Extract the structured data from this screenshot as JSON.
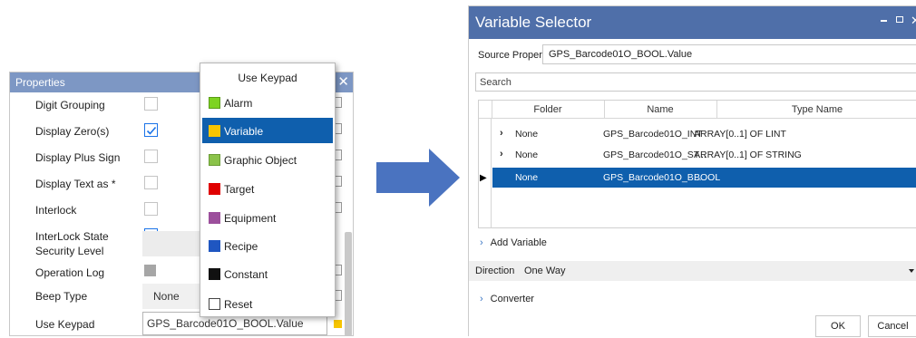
{
  "properties_panel": {
    "title": "Properties",
    "rows": [
      {
        "label": "Digit Grouping",
        "checked": false
      },
      {
        "label": "Display Zero(s)",
        "checked": true
      },
      {
        "label": "Display Plus Sign",
        "checked": false
      },
      {
        "label": "Display Text as *",
        "checked": false
      },
      {
        "label": "Interlock",
        "checked": false
      },
      {
        "label": "InterLock State",
        "checked": true
      },
      {
        "label": "Security Level"
      },
      {
        "label": "Operation Log"
      },
      {
        "label": "Beep Type",
        "value": "None"
      },
      {
        "label": "Use Keypad",
        "value": "GPS_Barcode01O_BOOL.Value"
      }
    ]
  },
  "keypad_dropdown": {
    "title": "Use Keypad",
    "items": [
      {
        "label": "Alarm",
        "color": "#7ed321"
      },
      {
        "label": "Variable",
        "color": "#f7c500",
        "selected": true
      },
      {
        "label": "Graphic Object",
        "color": "#8bc34a"
      },
      {
        "label": "Target",
        "color": "#e00000"
      },
      {
        "label": "Equipment",
        "color": "#9c4f9c"
      },
      {
        "label": "Recipe",
        "color": "#1f56c1"
      },
      {
        "label": "Constant",
        "color": "#111111"
      },
      {
        "label": "Reset",
        "color": "#ffffff"
      }
    ]
  },
  "variable_selector": {
    "title": "Variable Selector",
    "source_property_label": "Source Property",
    "source_property_value": "GPS_Barcode01O_BOOL.Value",
    "search_placeholder": "Search",
    "columns": [
      "Folder",
      "Name",
      "Type Name"
    ],
    "rows": [
      {
        "folder": "None",
        "name": "GPS_Barcode01O_INT",
        "type": "ARRAY[0..1] OF LINT",
        "expandable": true
      },
      {
        "folder": "None",
        "name": "GPS_Barcode01O_ST...",
        "type": "ARRAY[0..1] OF STRING",
        "expandable": true
      },
      {
        "folder": "None",
        "name": "GPS_Barcode01O_B...",
        "type": "BOOL",
        "selected": true
      }
    ],
    "add_variable_label": "Add Variable",
    "direction_label": "Direction",
    "direction_value": "One Way",
    "converter_label": "Converter",
    "ok_label": "OK",
    "cancel_label": "Cancel"
  },
  "colors": {
    "accent": "#0f5fad",
    "titlebar": "#4f6fa9",
    "properties_header": "#7d97c4",
    "arrow": "#4a73c0"
  }
}
